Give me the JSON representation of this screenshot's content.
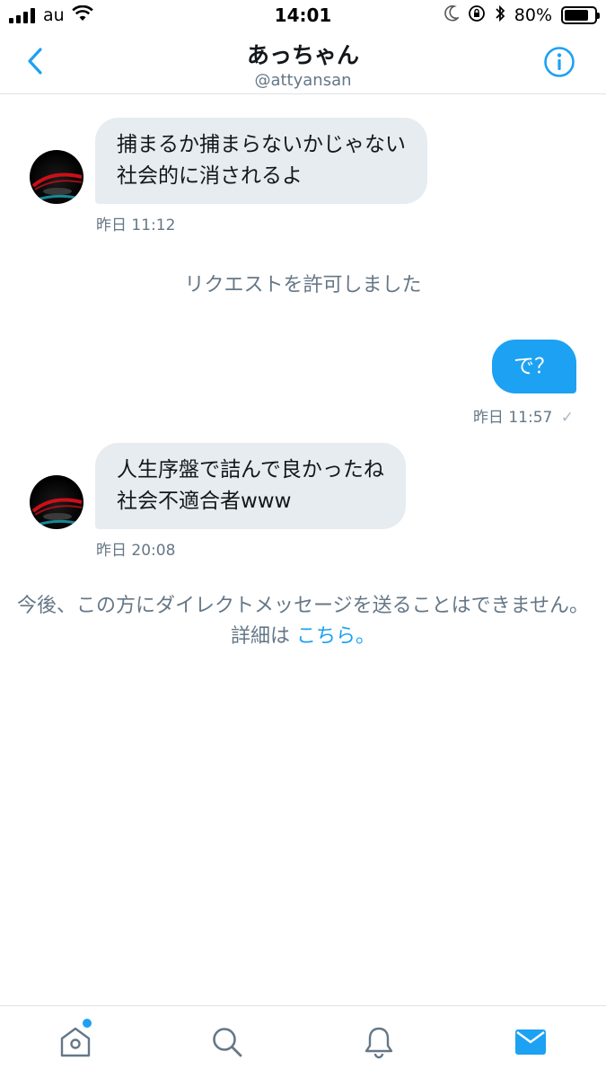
{
  "status_bar": {
    "carrier": "au",
    "time": "14:01",
    "battery": "80%",
    "battery_level": 0.8
  },
  "header": {
    "title": "あっちゃん",
    "handle": "@attyansan",
    "back_icon": "chevron-left-icon",
    "info_icon": "info-icon"
  },
  "conversation": {
    "messages": [
      {
        "direction": "incoming",
        "lines": [
          "捕まるか捕まらないかじゃない",
          "社会的に消されるよ"
        ],
        "time": "昨日 11:12"
      },
      {
        "direction": "system",
        "text": "リクエストを許可しました"
      },
      {
        "direction": "outgoing",
        "text": "で？",
        "time": "昨日 11:57",
        "status": "✓"
      },
      {
        "direction": "incoming",
        "lines": [
          "人生序盤で詰んで良かったね",
          "社会不適合者www"
        ],
        "time": "昨日 20:08"
      }
    ],
    "notice": {
      "text": "今後、この方にダイレクトメッセージを送ることはできません。詳細は",
      "link": "こちら。"
    }
  },
  "tab_bar": {
    "tabs": [
      {
        "name": "home",
        "icon": "home-icon",
        "badge": true
      },
      {
        "name": "search",
        "icon": "search-icon",
        "badge": false
      },
      {
        "name": "notifications",
        "icon": "bell-icon",
        "badge": false
      },
      {
        "name": "messages",
        "icon": "mail-icon",
        "badge": false,
        "active": true
      }
    ]
  },
  "colors": {
    "accent": "#1da1f2",
    "bubble_incoming": "#e6ecf0",
    "secondary_text": "#657786",
    "inactive_icon": "#657786"
  }
}
